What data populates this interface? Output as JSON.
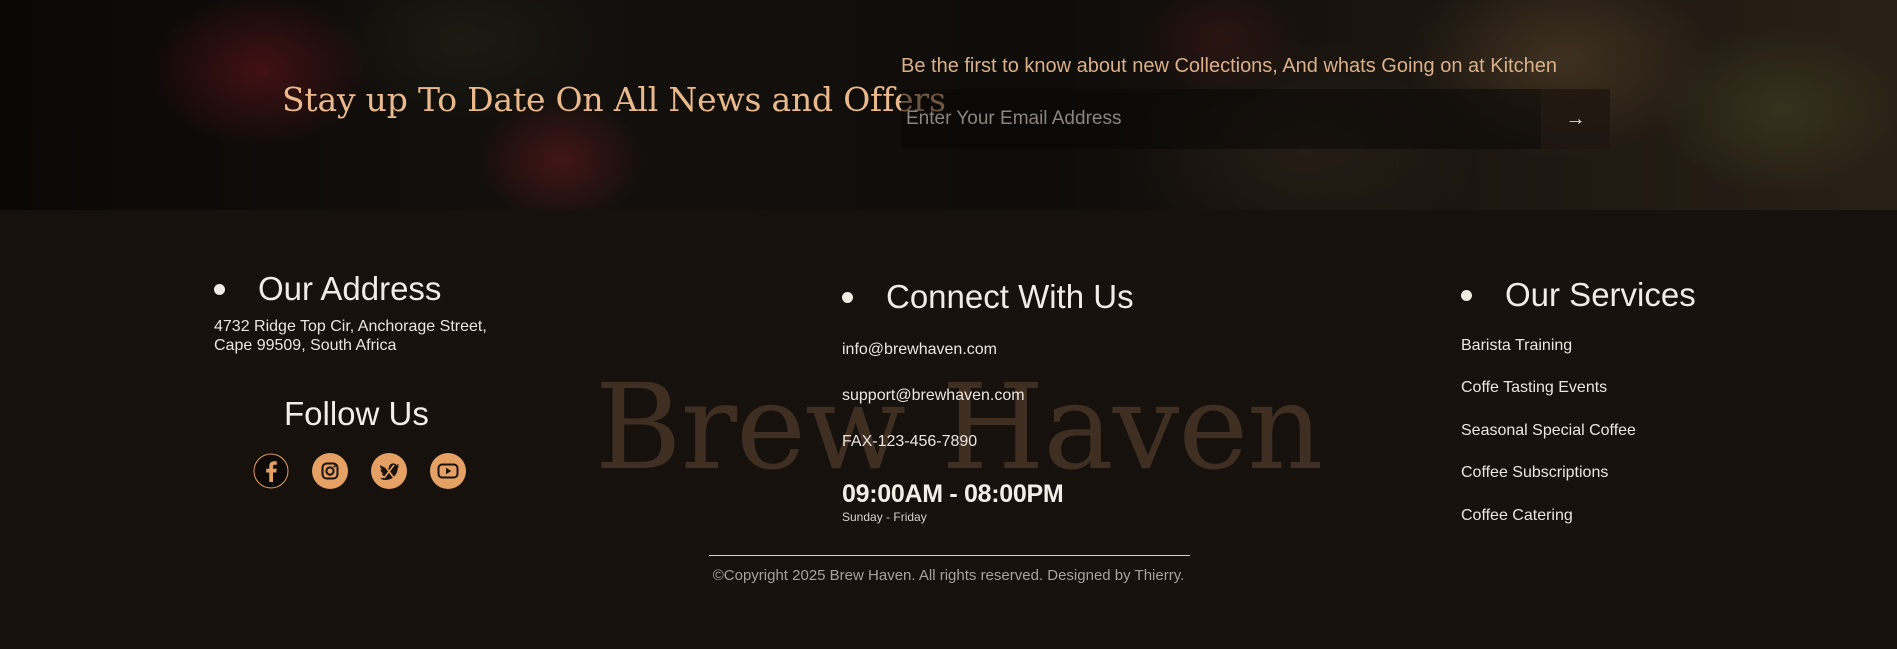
{
  "newsletter": {
    "title": "Stay up To Date On All News and Offers",
    "subtitle": "Be the first to know about new Collections, And whats Going on at Kitchen",
    "email_placeholder": "Enter Your Email Address",
    "submit_icon": "→"
  },
  "footer": {
    "watermark": "Brew Haven",
    "address": {
      "heading": "Our Address",
      "text": "4732 Ridge Top Cir, Anchorage Street, Cape 99509, South Africa"
    },
    "follow": {
      "heading": "Follow Us",
      "icons": [
        "facebook-icon",
        "instagram-icon",
        "twitter-icon",
        "youtube-icon"
      ]
    },
    "connect": {
      "heading": "Connect With Us",
      "email1": "info@brewhaven.com",
      "email2": "support@brewhaven.com",
      "fax": "FAX-123-456-7890",
      "hours": "09:00AM - 08:00PM",
      "days": "Sunday - Friday"
    },
    "services": {
      "heading": "Our Services",
      "items": [
        "Barista Training",
        "Coffe Tasting Events",
        "Seasonal Special Coffee",
        "Coffee Subscriptions",
        "Coffee Catering"
      ]
    },
    "copyright": "©Copyright 2025 Brew Haven. All rights reserved. Designed by Thierry."
  },
  "colors": {
    "accent": "#e5a064",
    "title_gold": "#e9b98c",
    "background": "#16110d"
  }
}
